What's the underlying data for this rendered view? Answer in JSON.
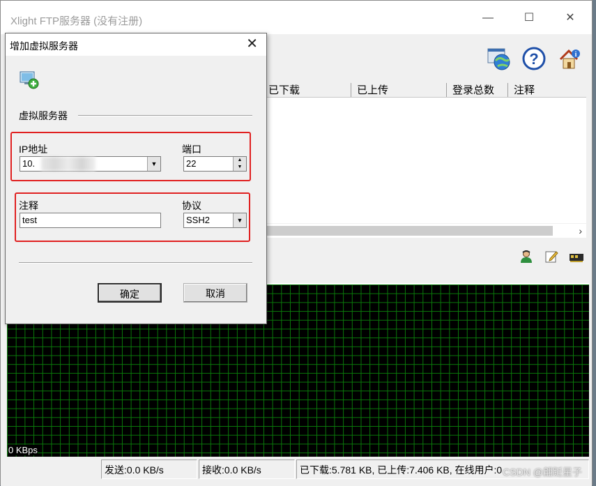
{
  "main_window": {
    "title": "Xlight FTP服务器 (没有注册)",
    "minimize": "—",
    "maximize": "☐",
    "close": "✕",
    "toolbar_icons": [
      "web-globe-icon",
      "help-icon",
      "home-info-icon"
    ],
    "list_columns": [
      "已下载",
      "已上传",
      "登录总数",
      "注释"
    ],
    "scroll_arrow": "›",
    "small_icons": [
      "user-icon",
      "edit-icon",
      "network-card-icon"
    ],
    "graph_label": "0 KBps",
    "status": {
      "send": "发送:0.0 KB/s",
      "receive": "接收:0.0 KB/s",
      "totals": "已下载:5.781 KB, 已上传:7.406 KB, 在线用户:0"
    },
    "watermark": "CSDN @翩跹星子"
  },
  "dialog": {
    "title": "增加虚拟服务器",
    "close": "✕",
    "icon": "add-server-icon",
    "group_label": "虚拟服务器",
    "ip_label": "IP地址",
    "ip_value": "10.",
    "port_label": "端口",
    "port_value": "22",
    "comment_label": "注释",
    "comment_value": "test",
    "protocol_label": "协议",
    "protocol_value": "SSH2",
    "ok_label": "确定",
    "cancel_label": "取消"
  },
  "colors": {
    "highlight": "#e02020",
    "graph_bg": "#000000",
    "graph_grid": "#0a7a0a"
  }
}
